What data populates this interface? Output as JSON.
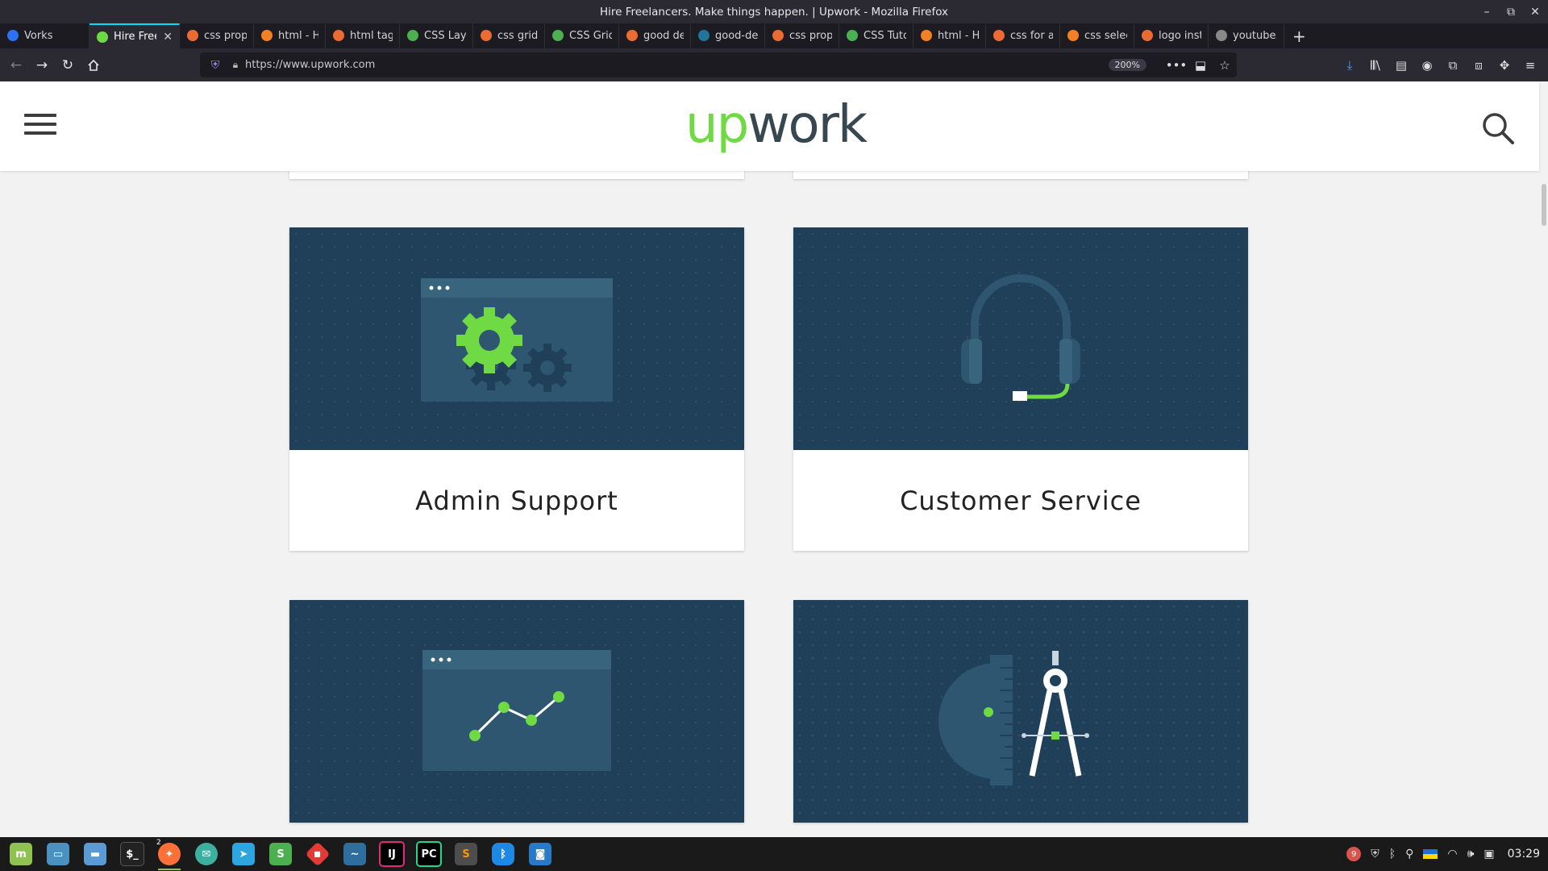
{
  "window": {
    "title": "Hire Freelancers. Make things happen. | Upwork - Mozilla Firefox",
    "controls": [
      "–",
      "⧉",
      "✕"
    ]
  },
  "tabs": [
    {
      "label": "Vorks",
      "icon_color": "#2f6ff5",
      "icon": "vorks-icon"
    },
    {
      "label": "Hire Freel",
      "icon_color": "#6fda44",
      "icon": "upwork-favicon",
      "active": true
    },
    {
      "label": "css propert",
      "icon_color": "#ec6b33",
      "icon": "duckduckgo-icon"
    },
    {
      "label": "html - How",
      "icon_color": "#f48024",
      "icon": "stackoverflow-icon"
    },
    {
      "label": "html taglin",
      "icon_color": "#ec6b33",
      "icon": "duckduckgo-icon"
    },
    {
      "label": "CSS Layout",
      "icon_color": "#4caf50",
      "icon": "w3schools-icon"
    },
    {
      "label": "css grid wic",
      "icon_color": "#ec6b33",
      "icon": "duckduckgo-icon"
    },
    {
      "label": "CSS Grid Co",
      "icon_color": "#4caf50",
      "icon": "w3schools-icon"
    },
    {
      "label": "good deed",
      "icon_color": "#ec6b33",
      "icon": "duckduckgo-icon"
    },
    {
      "label": "good-deed",
      "icon_color": "#21759b",
      "icon": "wordpress-icon"
    },
    {
      "label": "css propert",
      "icon_color": "#ec6b33",
      "icon": "duckduckgo-icon"
    },
    {
      "label": "CSS Tutoria",
      "icon_color": "#4caf50",
      "icon": "w3schools-icon"
    },
    {
      "label": "html - How",
      "icon_color": "#f48024",
      "icon": "stackoverflow-icon"
    },
    {
      "label": "css for all c",
      "icon_color": "#ec6b33",
      "icon": "duckduckgo-icon"
    },
    {
      "label": "css selecto",
      "icon_color": "#f48024",
      "icon": "stackoverflow-icon"
    },
    {
      "label": "logo insta p",
      "icon_color": "#ec6b33",
      "icon": "duckduckgo-icon"
    },
    {
      "label": "youtube.pr",
      "icon_color": "#888888",
      "icon": "generic-page-icon"
    }
  ],
  "nav": {
    "url": "https://www.upwork.com",
    "zoom": "200%"
  },
  "site": {
    "logo_up": "up",
    "logo_work": "work",
    "brand_green": "#6fda44",
    "card_bg": "#1f4058"
  },
  "categories": [
    {
      "label": "Admin Support",
      "illustration": "gears-window-icon"
    },
    {
      "label": "Customer Service",
      "illustration": "headset-icon"
    },
    {
      "label": "",
      "illustration": "analytics-chart-icon"
    },
    {
      "label": "",
      "illustration": "compass-ruler-icon"
    }
  ],
  "taskbar": {
    "apps": [
      "mint-menu",
      "show-desktop",
      "files",
      "terminal",
      "firefox",
      "mail",
      "telegram",
      "slack",
      "git",
      "mysql-workbench",
      "intellij",
      "pycharm",
      "sublime-text",
      "bluetooth-manager",
      "screenshot"
    ],
    "firefox_count": "2",
    "tray_badge": "9",
    "clock": "03:29"
  }
}
